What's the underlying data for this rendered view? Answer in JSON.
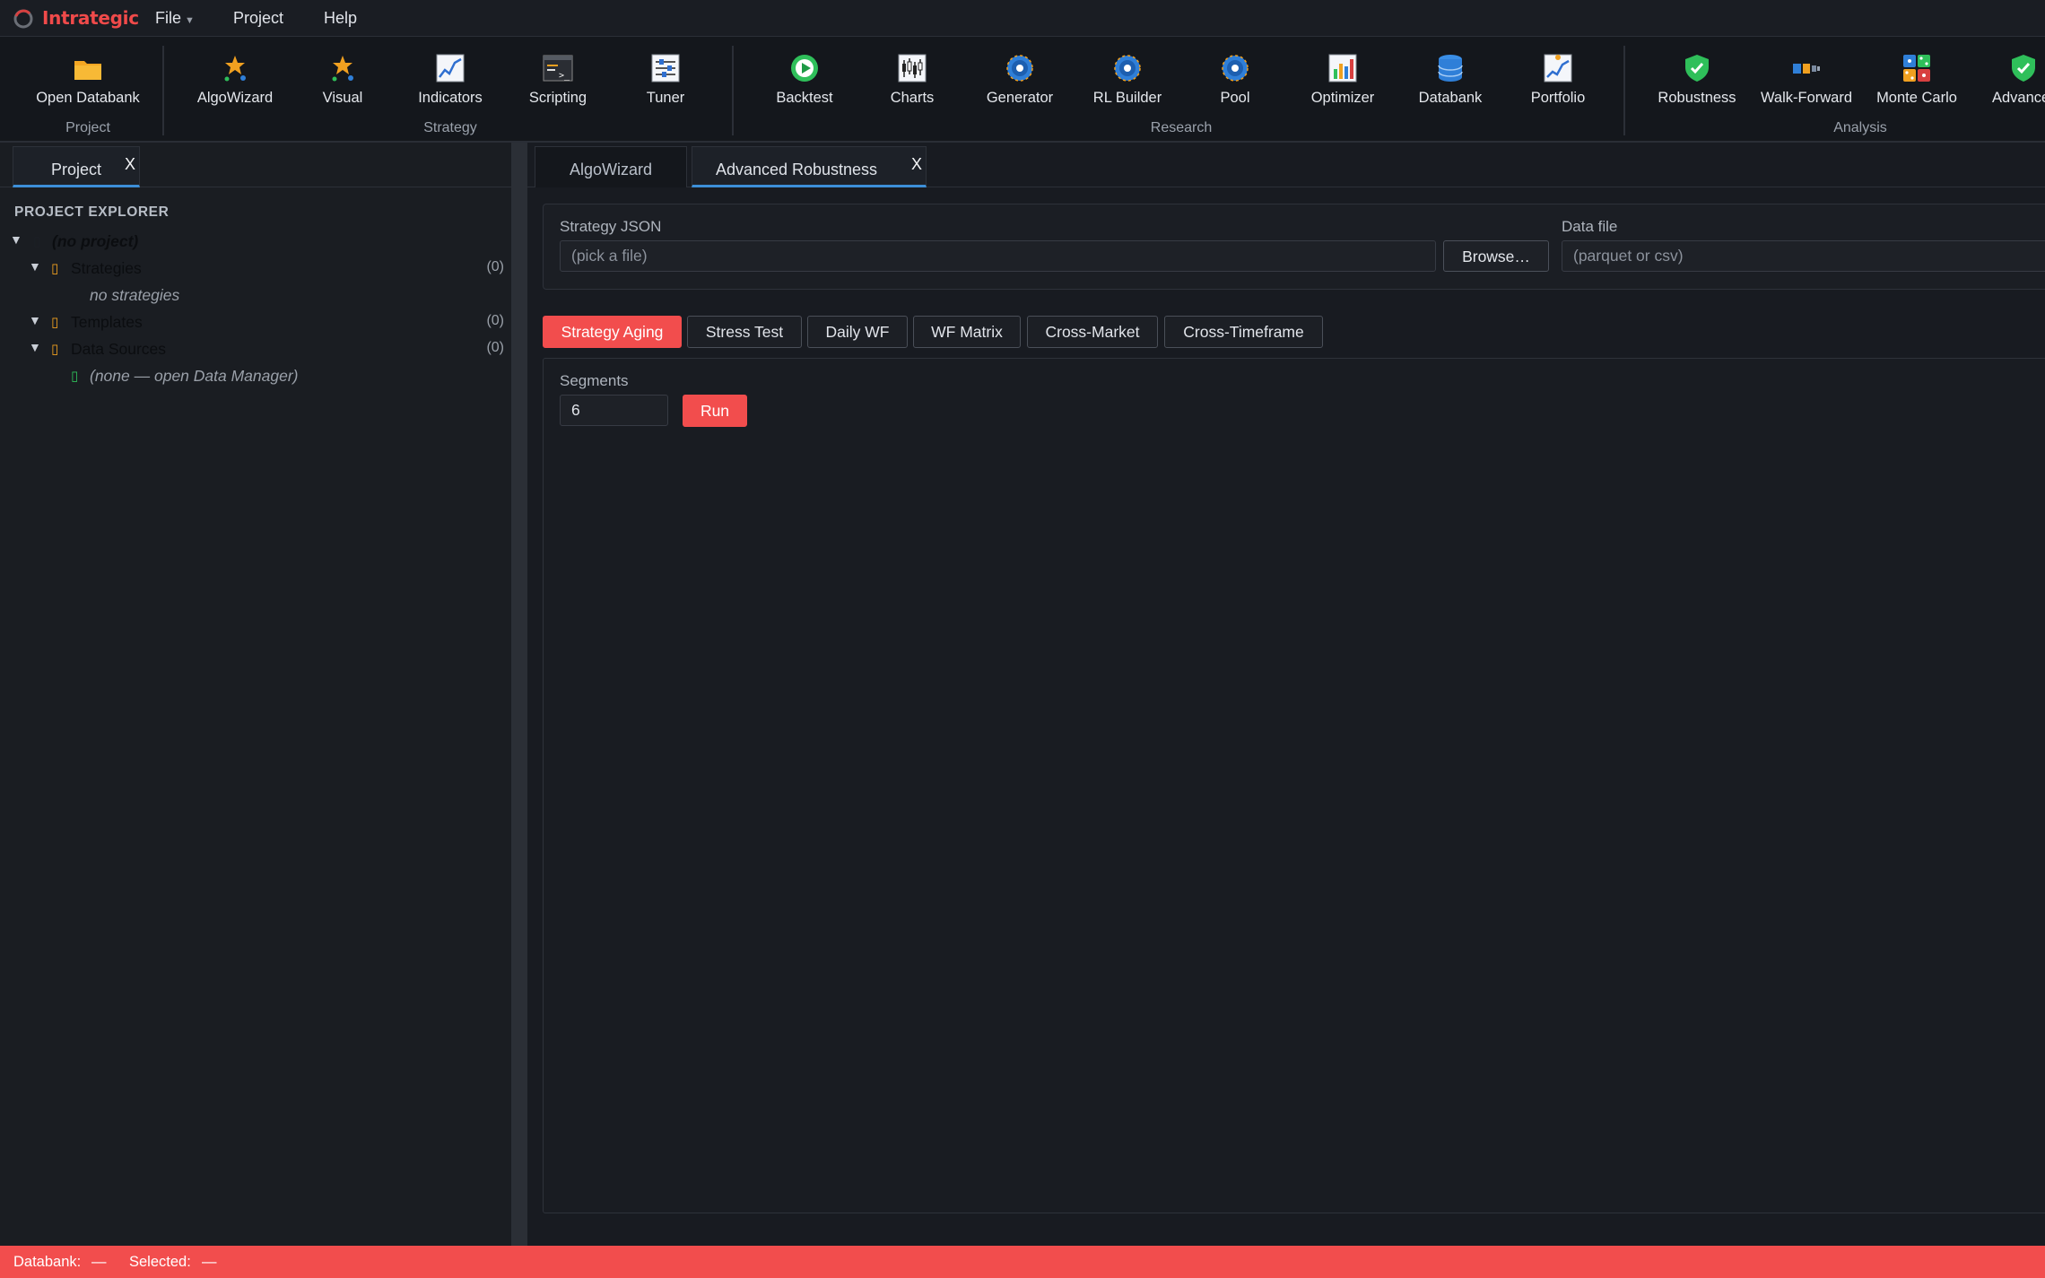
{
  "app": {
    "name": "Intrategic"
  },
  "menu": {
    "file": "File",
    "project": "Project",
    "help": "Help"
  },
  "ribbon": {
    "groups": {
      "project": "Project",
      "strategy": "Strategy",
      "research": "Research",
      "analysis": "Analysis"
    },
    "items": {
      "open_databank": "Open Databank",
      "algowizard": "AlgoWizard",
      "visual": "Visual",
      "indicators": "Indicators",
      "scripting": "Scripting",
      "tuner": "Tuner",
      "backtest": "Backtest",
      "charts": "Charts",
      "generator": "Generator",
      "rl_builder": "RL Builder",
      "pool": "Pool",
      "optimizer": "Optimizer",
      "databank": "Databank",
      "portfolio": "Portfolio",
      "robustness": "Robustness",
      "walk_forward": "Walk-Forward",
      "monte_carlo": "Monte Carlo",
      "advanced": "Advance"
    },
    "colors": {
      "accent_green": "#2fbf5a",
      "accent_blue": "#2f7fd8",
      "accent_orange": "#f0a020"
    }
  },
  "left": {
    "tab": "Project",
    "close": "X",
    "explorer_title": "PROJECT EXPLORER",
    "tree": {
      "root": "(no project)",
      "strategies": "Strategies",
      "strategies_count": "(0)",
      "no_strategies": "no strategies",
      "templates": "Templates",
      "templates_count": "(0)",
      "data_sources": "Data Sources",
      "data_sources_count": "(0)",
      "no_data": "(none — open Data Manager)"
    }
  },
  "right": {
    "tabs": {
      "algowizard": "AlgoWizard",
      "advanced_robustness": "Advanced Robustness",
      "close": "X"
    },
    "strategy_json": {
      "label": "Strategy JSON",
      "placeholder": "(pick a file)",
      "browse": "Browse…"
    },
    "data_file": {
      "label": "Data file",
      "placeholder": "(parquet or csv)"
    },
    "subtabs": [
      "Strategy Aging",
      "Stress Test",
      "Daily WF",
      "WF Matrix",
      "Cross-Market",
      "Cross-Timeframe"
    ],
    "segments": {
      "label": "Segments",
      "value": "6"
    },
    "run": "Run"
  },
  "status": {
    "databank_label": "Databank:",
    "databank_value": "—",
    "selected_label": "Selected:",
    "selected_value": "—"
  },
  "colors": {
    "accent_red": "#f24d4d",
    "tab_underline": "#3d8fd8",
    "background": "#181b21"
  }
}
